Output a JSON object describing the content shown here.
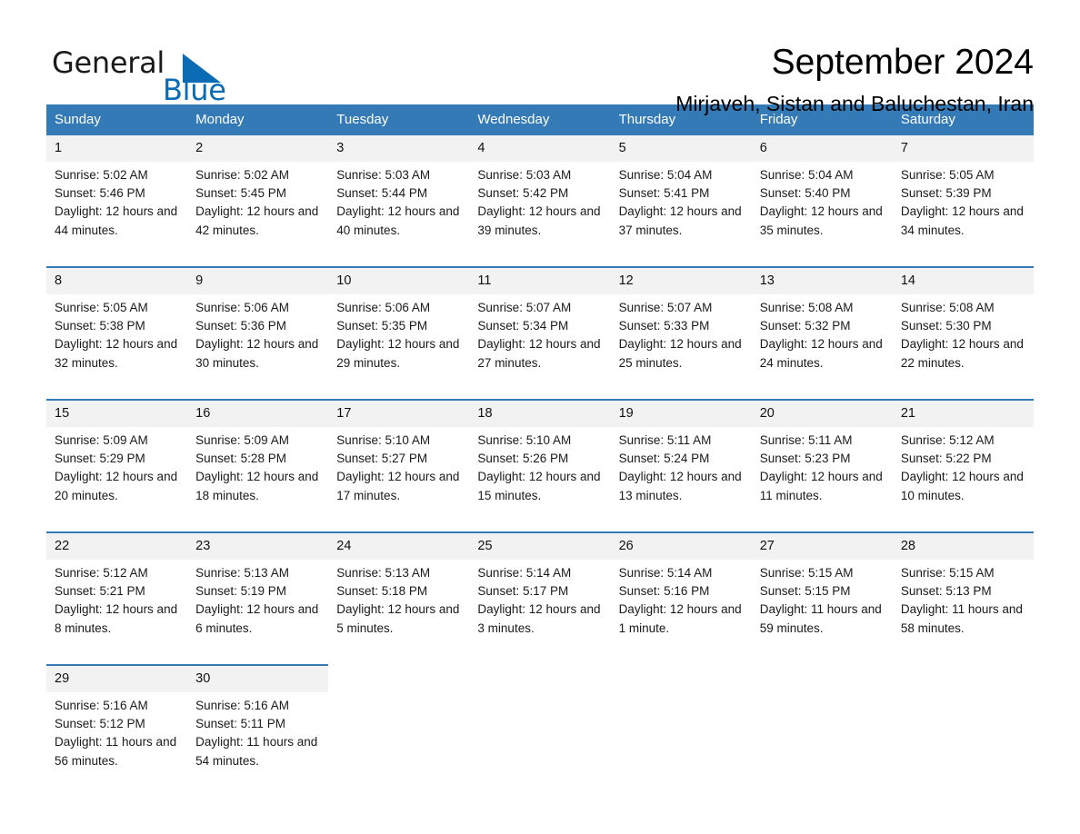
{
  "brand": {
    "name_dark": "General",
    "name_blue": "Blue",
    "triangle_color": "#0b6cb5"
  },
  "header": {
    "title": "September 2024",
    "subtitle": "Mirjaveh, Sistan and Baluchestan, Iran"
  },
  "theme": {
    "header_bg": "#337ab7",
    "daynum_bg": "#f2f2f2",
    "accent": "#0b6cb5"
  },
  "calendar": {
    "weekday_headers": [
      "Sunday",
      "Monday",
      "Tuesday",
      "Wednesday",
      "Thursday",
      "Friday",
      "Saturday"
    ],
    "weeks": [
      [
        {
          "day": "1",
          "sunrise": "Sunrise: 5:02 AM",
          "sunset": "Sunset: 5:46 PM",
          "daylight": "Daylight: 12 hours and 44 minutes."
        },
        {
          "day": "2",
          "sunrise": "Sunrise: 5:02 AM",
          "sunset": "Sunset: 5:45 PM",
          "daylight": "Daylight: 12 hours and 42 minutes."
        },
        {
          "day": "3",
          "sunrise": "Sunrise: 5:03 AM",
          "sunset": "Sunset: 5:44 PM",
          "daylight": "Daylight: 12 hours and 40 minutes."
        },
        {
          "day": "4",
          "sunrise": "Sunrise: 5:03 AM",
          "sunset": "Sunset: 5:42 PM",
          "daylight": "Daylight: 12 hours and 39 minutes."
        },
        {
          "day": "5",
          "sunrise": "Sunrise: 5:04 AM",
          "sunset": "Sunset: 5:41 PM",
          "daylight": "Daylight: 12 hours and 37 minutes."
        },
        {
          "day": "6",
          "sunrise": "Sunrise: 5:04 AM",
          "sunset": "Sunset: 5:40 PM",
          "daylight": "Daylight: 12 hours and 35 minutes."
        },
        {
          "day": "7",
          "sunrise": "Sunrise: 5:05 AM",
          "sunset": "Sunset: 5:39 PM",
          "daylight": "Daylight: 12 hours and 34 minutes."
        }
      ],
      [
        {
          "day": "8",
          "sunrise": "Sunrise: 5:05 AM",
          "sunset": "Sunset: 5:38 PM",
          "daylight": "Daylight: 12 hours and 32 minutes."
        },
        {
          "day": "9",
          "sunrise": "Sunrise: 5:06 AM",
          "sunset": "Sunset: 5:36 PM",
          "daylight": "Daylight: 12 hours and 30 minutes."
        },
        {
          "day": "10",
          "sunrise": "Sunrise: 5:06 AM",
          "sunset": "Sunset: 5:35 PM",
          "daylight": "Daylight: 12 hours and 29 minutes."
        },
        {
          "day": "11",
          "sunrise": "Sunrise: 5:07 AM",
          "sunset": "Sunset: 5:34 PM",
          "daylight": "Daylight: 12 hours and 27 minutes."
        },
        {
          "day": "12",
          "sunrise": "Sunrise: 5:07 AM",
          "sunset": "Sunset: 5:33 PM",
          "daylight": "Daylight: 12 hours and 25 minutes."
        },
        {
          "day": "13",
          "sunrise": "Sunrise: 5:08 AM",
          "sunset": "Sunset: 5:32 PM",
          "daylight": "Daylight: 12 hours and 24 minutes."
        },
        {
          "day": "14",
          "sunrise": "Sunrise: 5:08 AM",
          "sunset": "Sunset: 5:30 PM",
          "daylight": "Daylight: 12 hours and 22 minutes."
        }
      ],
      [
        {
          "day": "15",
          "sunrise": "Sunrise: 5:09 AM",
          "sunset": "Sunset: 5:29 PM",
          "daylight": "Daylight: 12 hours and 20 minutes."
        },
        {
          "day": "16",
          "sunrise": "Sunrise: 5:09 AM",
          "sunset": "Sunset: 5:28 PM",
          "daylight": "Daylight: 12 hours and 18 minutes."
        },
        {
          "day": "17",
          "sunrise": "Sunrise: 5:10 AM",
          "sunset": "Sunset: 5:27 PM",
          "daylight": "Daylight: 12 hours and 17 minutes."
        },
        {
          "day": "18",
          "sunrise": "Sunrise: 5:10 AM",
          "sunset": "Sunset: 5:26 PM",
          "daylight": "Daylight: 12 hours and 15 minutes."
        },
        {
          "day": "19",
          "sunrise": "Sunrise: 5:11 AM",
          "sunset": "Sunset: 5:24 PM",
          "daylight": "Daylight: 12 hours and 13 minutes."
        },
        {
          "day": "20",
          "sunrise": "Sunrise: 5:11 AM",
          "sunset": "Sunset: 5:23 PM",
          "daylight": "Daylight: 12 hours and 11 minutes."
        },
        {
          "day": "21",
          "sunrise": "Sunrise: 5:12 AM",
          "sunset": "Sunset: 5:22 PM",
          "daylight": "Daylight: 12 hours and 10 minutes."
        }
      ],
      [
        {
          "day": "22",
          "sunrise": "Sunrise: 5:12 AM",
          "sunset": "Sunset: 5:21 PM",
          "daylight": "Daylight: 12 hours and 8 minutes."
        },
        {
          "day": "23",
          "sunrise": "Sunrise: 5:13 AM",
          "sunset": "Sunset: 5:19 PM",
          "daylight": "Daylight: 12 hours and 6 minutes."
        },
        {
          "day": "24",
          "sunrise": "Sunrise: 5:13 AM",
          "sunset": "Sunset: 5:18 PM",
          "daylight": "Daylight: 12 hours and 5 minutes."
        },
        {
          "day": "25",
          "sunrise": "Sunrise: 5:14 AM",
          "sunset": "Sunset: 5:17 PM",
          "daylight": "Daylight: 12 hours and 3 minutes."
        },
        {
          "day": "26",
          "sunrise": "Sunrise: 5:14 AM",
          "sunset": "Sunset: 5:16 PM",
          "daylight": "Daylight: 12 hours and 1 minute."
        },
        {
          "day": "27",
          "sunrise": "Sunrise: 5:15 AM",
          "sunset": "Sunset: 5:15 PM",
          "daylight": "Daylight: 11 hours and 59 minutes."
        },
        {
          "day": "28",
          "sunrise": "Sunrise: 5:15 AM",
          "sunset": "Sunset: 5:13 PM",
          "daylight": "Daylight: 11 hours and 58 minutes."
        }
      ],
      [
        {
          "day": "29",
          "sunrise": "Sunrise: 5:16 AM",
          "sunset": "Sunset: 5:12 PM",
          "daylight": "Daylight: 11 hours and 56 minutes."
        },
        {
          "day": "30",
          "sunrise": "Sunrise: 5:16 AM",
          "sunset": "Sunset: 5:11 PM",
          "daylight": "Daylight: 11 hours and 54 minutes."
        },
        null,
        null,
        null,
        null,
        null
      ]
    ]
  }
}
